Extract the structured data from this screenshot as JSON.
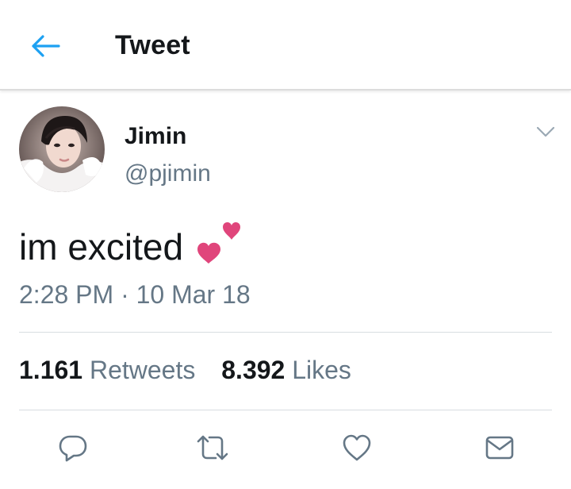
{
  "header": {
    "title": "Tweet"
  },
  "tweet": {
    "author_name": "Jimin",
    "author_handle": "@pjimin",
    "text": "im excited",
    "emoji": "two-hearts",
    "timestamp": "2:28 PM · 10 Mar 18"
  },
  "stats": {
    "retweets_count": "1.161",
    "retweets_label": "Retweets",
    "likes_count": "8.392",
    "likes_label": "Likes"
  },
  "actions": [
    "reply-icon",
    "retweet-icon",
    "like-icon",
    "share-icon"
  ],
  "colors": {
    "accent": "#1da1f2",
    "text": "#14171a",
    "secondary": "#657786",
    "divider": "#d8dde1",
    "heart": "#e0457b"
  }
}
